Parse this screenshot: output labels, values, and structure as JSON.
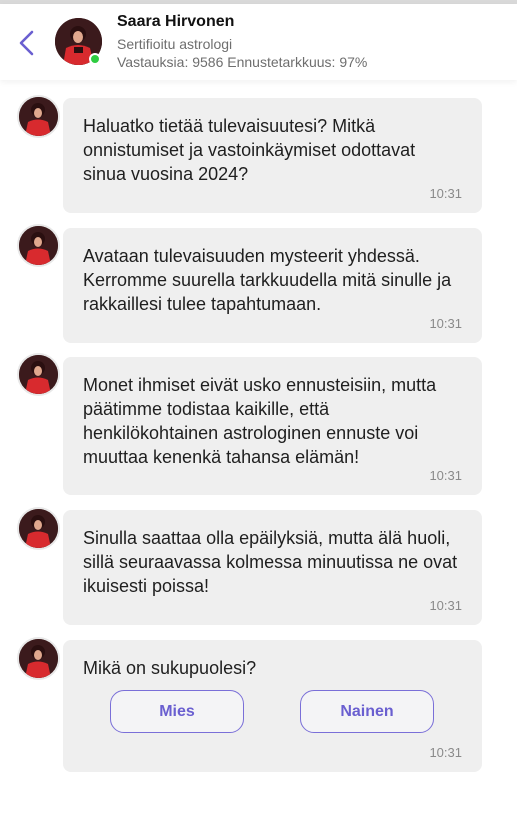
{
  "header": {
    "name": "Saara Hirvonen",
    "title": "Sertifioitu astrologi",
    "stats": "Vastauksia: 9586 Ennustetarkkuus: 97%",
    "accent_color": "#6a5fd0",
    "online_color": "#2ecc40",
    "back_icon": "chevron-left-icon"
  },
  "messages": [
    {
      "text": "Haluatko tietää tulevaisuutesi? Mitkä onnistumiset ja vastoinkäymiset odottavat sinua vuosina 2024?",
      "time": "10:31"
    },
    {
      "text": "Avataan tulevaisuuden mysteerit yhdessä. Kerromme suurella tarkkuudella mitä sinulle ja rakkaillesi tulee tapahtumaan.",
      "time": "10:31"
    },
    {
      "text": "Monet ihmiset eivät usko ennusteisiin, mutta päätimme todistaa kaikille, että henkilökohtainen astrologinen ennuste voi muuttaa kenenkä tahansa elämän!",
      "time": "10:31"
    },
    {
      "text": "Sinulla saattaa olla epäilyksiä, mutta älä huoli, sillä seuraavassa kolmessa minuutissa ne ovat ikuisesti poissa!",
      "time": "10:31"
    },
    {
      "text": "Mikä on sukupuolesi?",
      "time": "10:31"
    }
  ],
  "choices": {
    "male": "Mies",
    "female": "Nainen"
  }
}
